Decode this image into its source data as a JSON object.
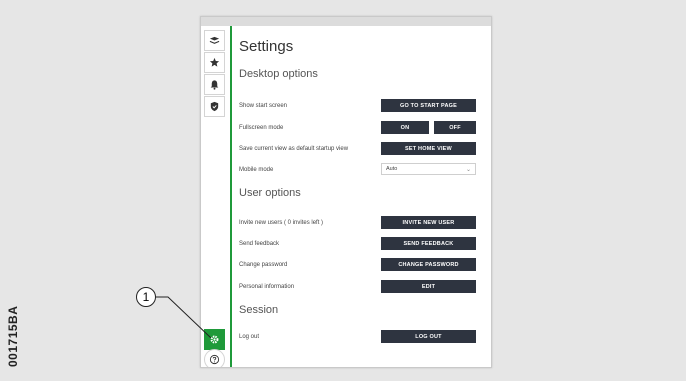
{
  "figure_code": "001715BA",
  "callout_number": "1",
  "settings": {
    "title": "Settings",
    "sections": {
      "desktop": "Desktop options",
      "user": "User options",
      "session": "Session"
    },
    "rows": {
      "start_screen": {
        "label": "Show start screen",
        "button": "GO TO START PAGE"
      },
      "fullscreen": {
        "label": "Fullscreen mode",
        "on": "ON",
        "off": "OFF"
      },
      "startup_view": {
        "label": "Save current view as default startup view",
        "button": "SET HOME VIEW"
      },
      "mobile": {
        "label": "Mobile mode",
        "value": "Auto"
      },
      "invite": {
        "label": "Invite new users ( 0 invites left )",
        "button": "INVITE NEW USER"
      },
      "feedback": {
        "label": "Send feedback",
        "button": "SEND FEEDBACK"
      },
      "password": {
        "label": "Change password",
        "button": "CHANGE PASSWORD"
      },
      "personal": {
        "label": "Personal information",
        "button": "EDIT"
      },
      "logout": {
        "label": "Log out",
        "button": "LOG OUT"
      }
    }
  },
  "sidebar_icons": [
    "layers-icon",
    "star-icon",
    "bell-icon",
    "shield-icon",
    "gear-icon",
    "help-icon"
  ],
  "colors": {
    "accent": "#1f9a3a",
    "button": "#2e3440"
  }
}
